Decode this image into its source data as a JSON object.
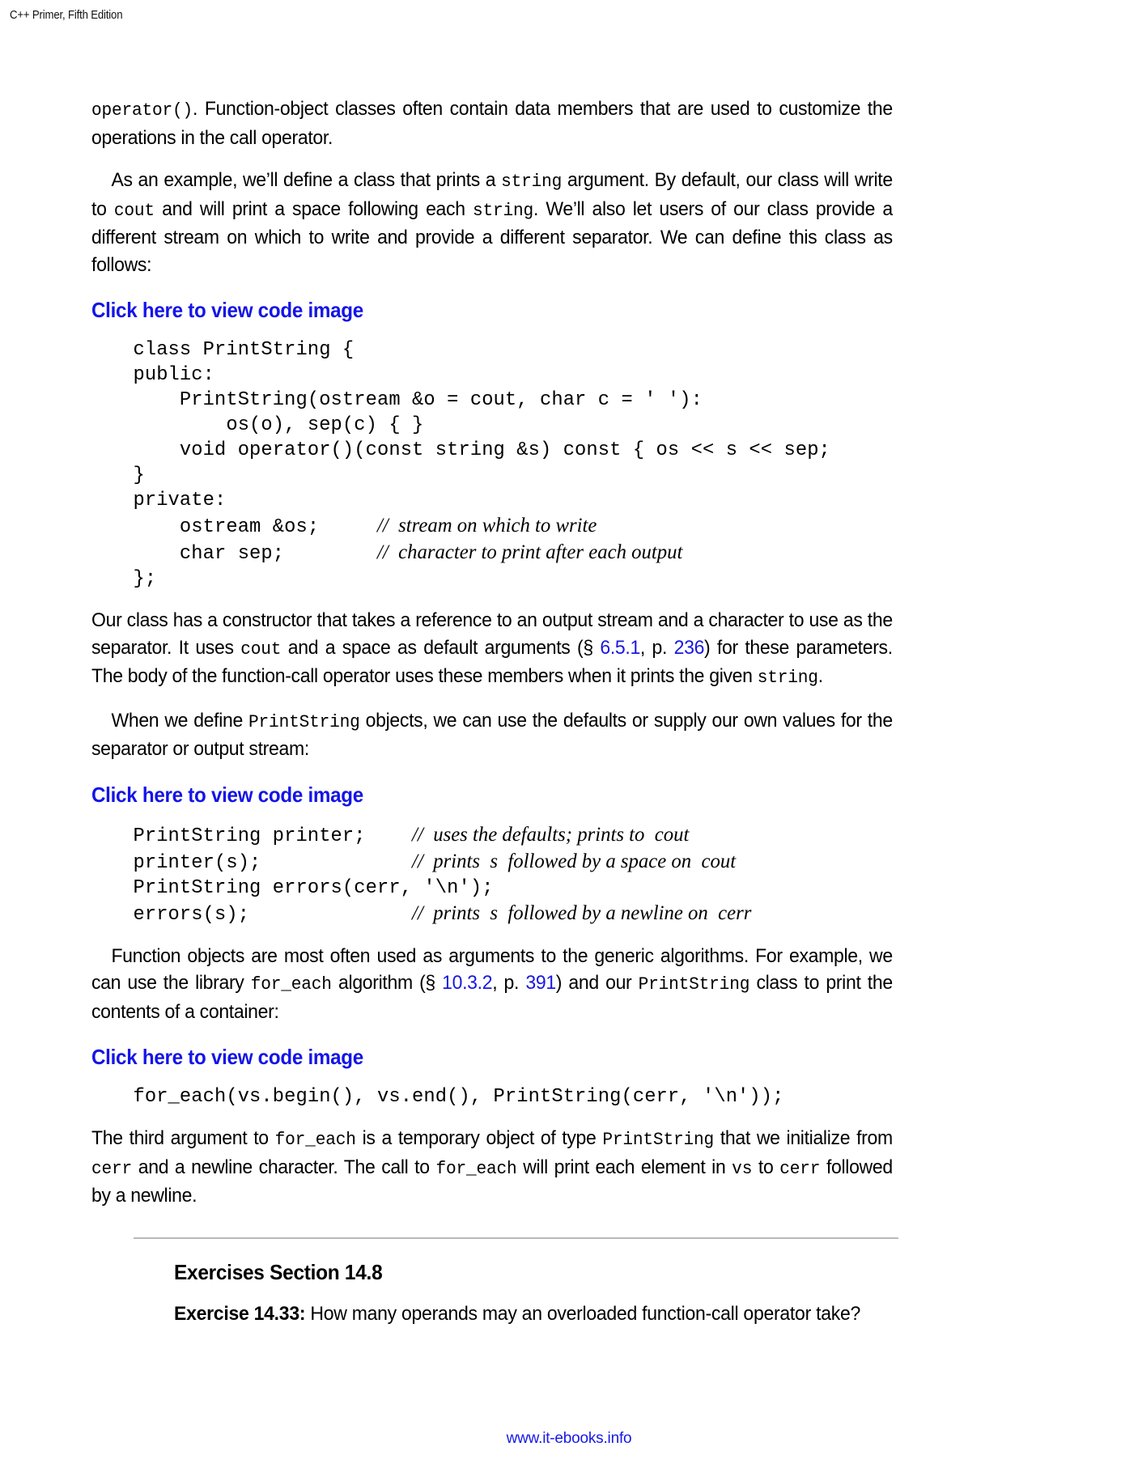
{
  "running_head": "C++ Primer, Fifth Edition",
  "paragraphs": {
    "p1": {
      "lead_code": "operator()",
      "text": ". Function-object classes often contain data members that are used to customize the operations in the call operator."
    },
    "p2": {
      "s1": "As an example, we’ll define a class that prints a ",
      "c1": "string",
      "s2": " argument. By default, our class will write to ",
      "c2": "cout",
      "s3": " and will print a space following each ",
      "c3": "string",
      "s4": ". We’ll also let users of our class provide a different stream on which to write and provide a different separator. We can define this class as follows:"
    },
    "p3": {
      "s1": "Our class has a constructor that takes a reference to an output stream and a character to use as the separator. It uses ",
      "c1": "cout",
      "s2": " and a space as default arguments (§ ",
      "link1": "6.5.1",
      "s3": ", p. ",
      "link2": "236",
      "s4": ") for these parameters. The body of the function-call operator uses these members when it prints the given ",
      "c2": "string",
      "s5": "."
    },
    "p4": {
      "s1": "When we define ",
      "c1": "PrintString",
      "s2": " objects, we can use the defaults or supply our own values for the separator or output stream:"
    },
    "p5": {
      "s1": "Function objects are most often used as arguments to the generic algorithms. For example, we can use the library ",
      "c1": "for_each",
      "s2": " algorithm (§ ",
      "link1": "10.3.2",
      "s3": ", p. ",
      "link2": "391",
      "s4": ") and our ",
      "c2": "PrintString",
      "s5": " class to print the contents of a container:"
    },
    "p6": {
      "s1": "The third argument to ",
      "c1": "for_each",
      "s2": " is a temporary object of type ",
      "c2": "PrintString",
      "s3": " that we initialize from ",
      "c3": "cerr",
      "s4": " and a newline character. The call to ",
      "c4": "for_each",
      "s5": " will print each element in ",
      "c5": "vs",
      "s6": " to ",
      "c6": "cerr",
      "s7": " followed by a newline."
    }
  },
  "code_link_label": "Click here to view code image",
  "code_blocks": {
    "block1": {
      "lines": [
        {
          "code": "class PrintString {"
        },
        {
          "code": "public:"
        },
        {
          "code": "    PrintString(ostream &o = cout, char c = ' '):"
        },
        {
          "code": "        os(o), sep(c) { }"
        },
        {
          "code": "    void operator()(const string &s) const { os << s << sep;"
        },
        {
          "code": "}"
        },
        {
          "code": "private:"
        },
        {
          "code": "    ostream &os;     ",
          "comment": "//  stream on which to write"
        },
        {
          "code": "    char sep;        ",
          "comment": "//  character to print after each output"
        },
        {
          "code": "};"
        }
      ]
    },
    "block2": {
      "lines": [
        {
          "code": "PrintString printer;    ",
          "comment": "//  uses the defaults; prints to  cout"
        },
        {
          "code": "printer(s);             ",
          "comment": "//  prints  s  followed by a space on  cout"
        },
        {
          "code": "PrintString errors(cerr, '\\n');"
        },
        {
          "code": "errors(s);              ",
          "comment": "//  prints  s  followed by a newline on  cerr"
        }
      ]
    },
    "block3": {
      "lines": [
        {
          "code": "for_each(vs.begin(), vs.end(), PrintString(cerr, '\\n'));"
        }
      ]
    }
  },
  "exercises": {
    "title": "Exercises Section 14.8",
    "items": [
      {
        "label": "Exercise 14.33:",
        "text": " How many operands may an overloaded function-call operator take?"
      }
    ]
  },
  "footer": {
    "url": "www.it-ebooks.info"
  },
  "colors": {
    "link_blue": "#1414e8",
    "xref_blue": "#1818e0",
    "rule_gray": "#b9b9b9"
  }
}
